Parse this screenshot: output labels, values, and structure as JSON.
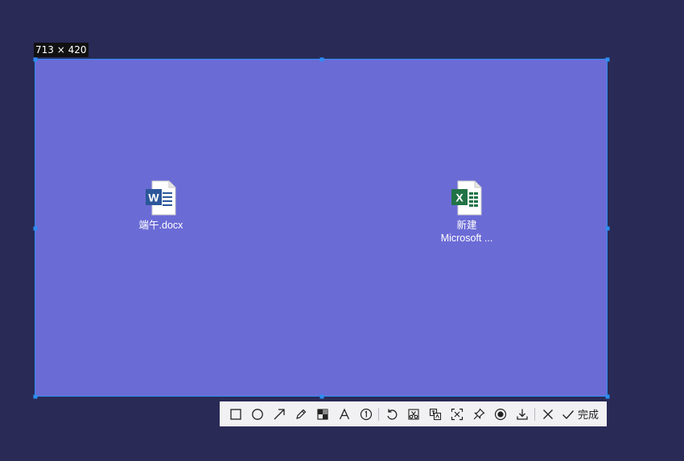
{
  "selection": {
    "size_label": "713 × 420"
  },
  "desktop": {
    "files": [
      {
        "name": "端午.docx",
        "name_line2": "",
        "icon": "word-document-icon"
      },
      {
        "name": "新建",
        "name_line2": "Microsoft ...",
        "icon": "excel-document-icon"
      }
    ]
  },
  "toolbar": {
    "tools": [
      "rectangle-icon",
      "ellipse-icon",
      "arrow-icon",
      "pencil-icon",
      "mosaic-icon",
      "text-icon",
      "number-marker-icon",
      "undo-icon",
      "cut-icon",
      "translate-icon",
      "ocr-scan-icon",
      "pin-icon",
      "record-icon",
      "download-icon",
      "close-icon",
      "check-icon"
    ],
    "done_label": "完成"
  },
  "colors": {
    "background": "#292a56",
    "selection_fill": "#6b6bd6",
    "selection_border": "#2d8cf0",
    "toolbar_bg": "#f1f1f3",
    "word_blue": "#2b579a",
    "excel_green": "#217346"
  }
}
